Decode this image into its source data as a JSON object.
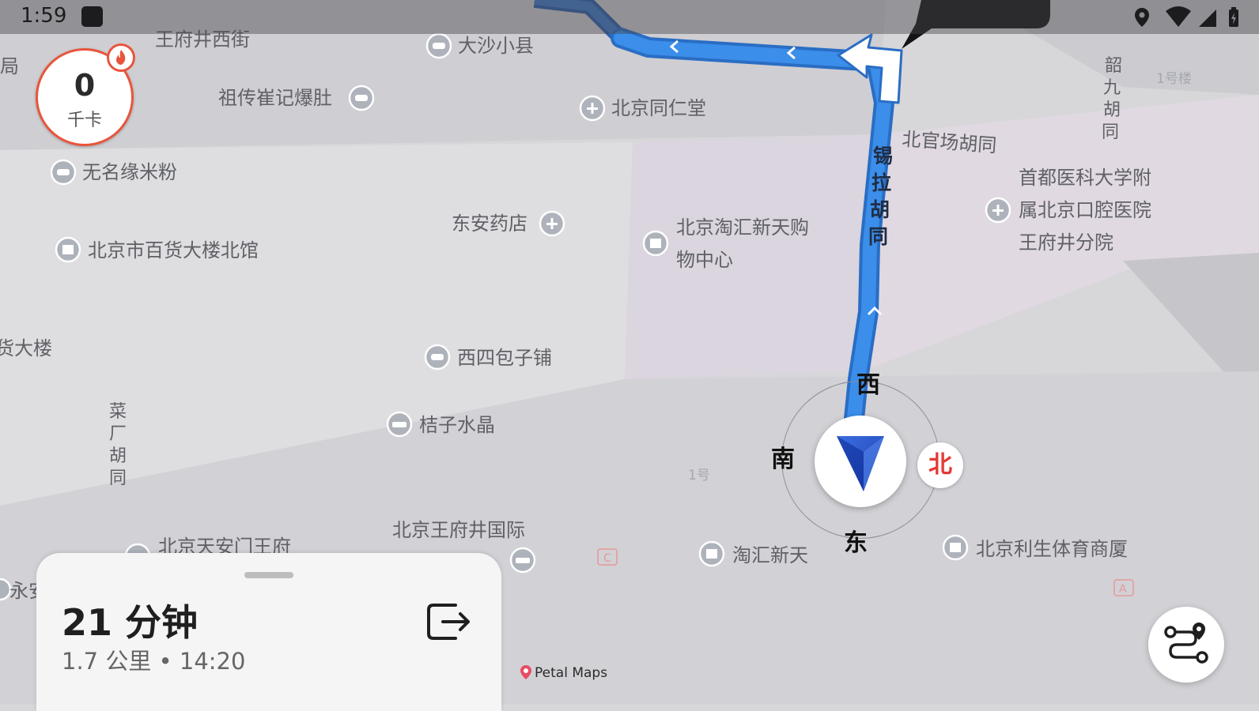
{
  "status_bar": {
    "time": "1:59"
  },
  "calories": {
    "value": "0",
    "unit": "千卡"
  },
  "eta": {
    "duration": "21 分钟",
    "distance_arrival": "1.7 公里 • 14:20"
  },
  "compass": {
    "north": "北",
    "south": "南",
    "east": "东",
    "west": "西"
  },
  "attribution": "Petal Maps",
  "streets": {
    "wangfujing_west": "王府井西街",
    "beiguanchang": "北官场胡同",
    "xila": [
      "锡",
      "拉",
      "胡",
      "同"
    ],
    "shaojiu": [
      "韶",
      "九",
      "胡",
      "同"
    ],
    "caichang": [
      "菜",
      "厂",
      "胡",
      "同"
    ]
  },
  "pois": {
    "dasha": "大沙小县",
    "cuiji": "祖传崔记爆肚",
    "tongrentang": "北京同仁堂",
    "wuming": "无名缘米粉",
    "dongan": "东安药店",
    "taohui_line1": "北京淘汇新天购",
    "taohui_line2": "物中心",
    "kouqiang_line1": "首都医科大学附",
    "kouqiang_line2": "属北京口腔医院",
    "kouqiang_line3": "王府井分院",
    "baihuo": "北京市百货大楼北馆",
    "huodalou": "货大楼",
    "xisi": "西四包子铺",
    "juzi": "桔子水晶",
    "tiananmen": "北京天安门王府",
    "wfj_intl": "北京王府井国际",
    "taohui2": "淘汇新天",
    "lisheng": "北京利生体育商厦",
    "yong": "永安",
    "edge_left": "局",
    "bldg_1": "1号楼",
    "bldg_1b": "1号"
  },
  "colors": {
    "route_blue": "#3b8eea",
    "route_outline": "#2a6dc4",
    "accent_red": "#e8553c",
    "north_red": "#e53935"
  }
}
